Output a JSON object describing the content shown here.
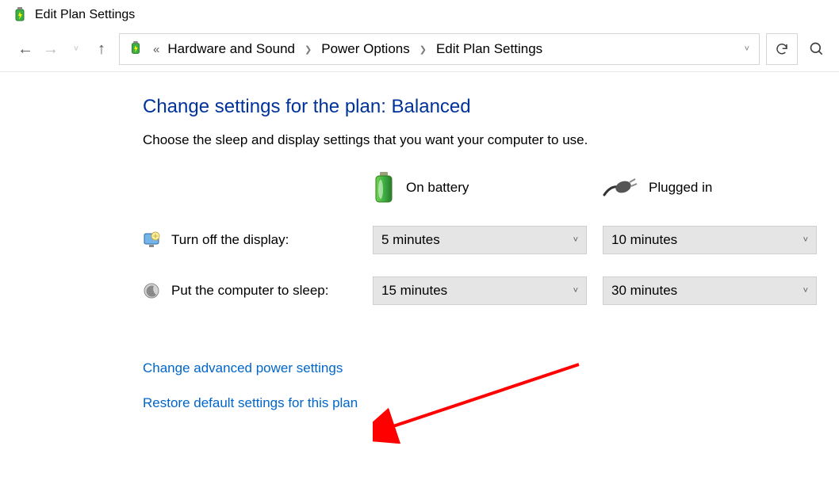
{
  "window": {
    "title": "Edit Plan Settings"
  },
  "breadcrumb": {
    "items": [
      "Hardware and Sound",
      "Power Options",
      "Edit Plan Settings"
    ]
  },
  "main": {
    "heading": "Change settings for the plan: Balanced",
    "subtitle": "Choose the sleep and display settings that you want your computer to use.",
    "columns": {
      "battery": "On battery",
      "plugged": "Plugged in"
    },
    "rows": [
      {
        "label": "Turn off the display:",
        "battery_value": "5 minutes",
        "plugged_value": "10 minutes"
      },
      {
        "label": "Put the computer to sleep:",
        "battery_value": "15 minutes",
        "plugged_value": "30 minutes"
      }
    ],
    "links": {
      "advanced": "Change advanced power settings",
      "restore": "Restore default settings for this plan"
    }
  }
}
